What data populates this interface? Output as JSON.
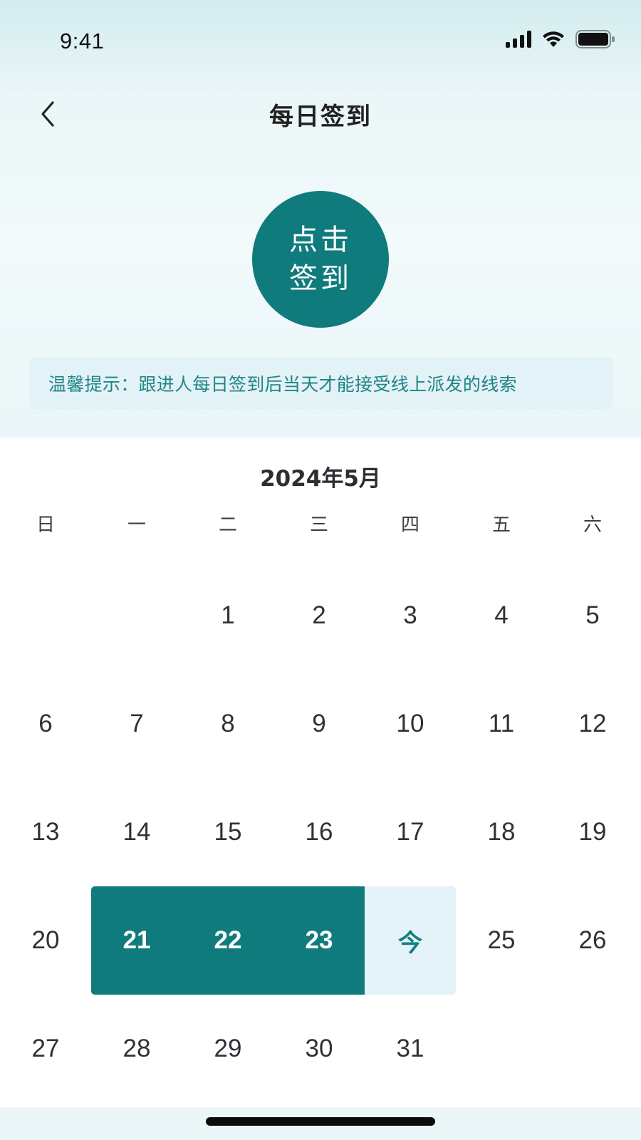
{
  "status_bar": {
    "time": "9:41"
  },
  "nav": {
    "title": "每日签到",
    "back_icon": "chevron-left-icon"
  },
  "checkin": {
    "line1": "点击",
    "line2": "签到",
    "color": "#107b7c"
  },
  "tip": {
    "text": "温馨提示：跟进人每日签到后当天才能接受线上派发的线索"
  },
  "calendar": {
    "month_title": "2024年5月",
    "weekdays": [
      "日",
      "一",
      "二",
      "三",
      "四",
      "五",
      "六"
    ],
    "weeks": [
      [
        "",
        "",
        "1",
        "2",
        "3",
        "4",
        "5"
      ],
      [
        "6",
        "7",
        "8",
        "9",
        "10",
        "11",
        "12"
      ],
      [
        "13",
        "14",
        "15",
        "16",
        "17",
        "18",
        "19"
      ],
      [
        "20",
        "21",
        "22",
        "23",
        "今",
        "25",
        "26"
      ],
      [
        "27",
        "28",
        "29",
        "30",
        "31",
        "",
        ""
      ]
    ],
    "signed_days": [
      "21",
      "22",
      "23"
    ],
    "today_label": "今",
    "signed_color": "#107b7c",
    "today_bg_color": "#e4f3f7"
  }
}
